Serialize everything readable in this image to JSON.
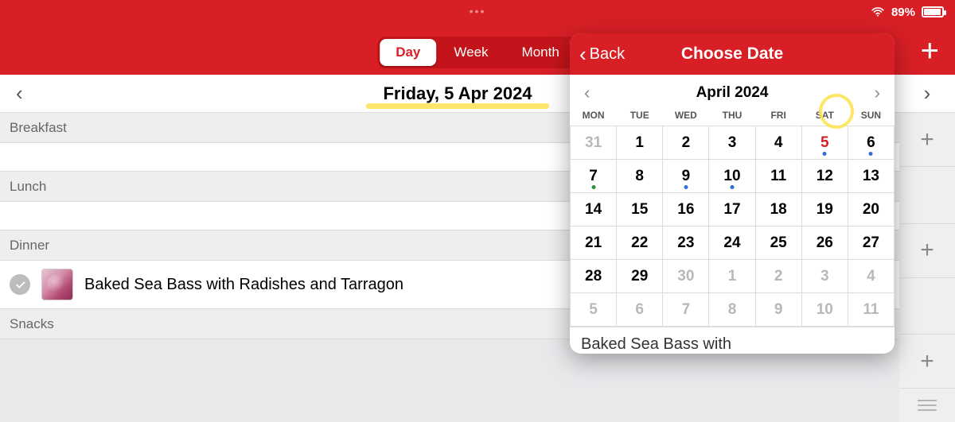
{
  "status": {
    "wifi": true,
    "battery_pct": "89%"
  },
  "segments": {
    "day": "Day",
    "week": "Week",
    "month": "Month",
    "active": "day"
  },
  "add_label": "+",
  "date_header": "Friday, 5 Apr 2024",
  "sections": {
    "breakfast": "Breakfast",
    "lunch": "Lunch",
    "dinner": "Dinner",
    "snacks": "Snacks"
  },
  "dinner_items": [
    {
      "name": "Baked Sea Bass with Radishes and Tarragon",
      "checked": true
    }
  ],
  "popover": {
    "back": "Back",
    "title": "Choose Date",
    "month_label": "April 2024",
    "dow": [
      "MON",
      "TUE",
      "WED",
      "THU",
      "FRI",
      "SAT",
      "SUN"
    ],
    "weeks": [
      [
        {
          "n": "31",
          "out": true
        },
        {
          "n": "1"
        },
        {
          "n": "2"
        },
        {
          "n": "3"
        },
        {
          "n": "4"
        },
        {
          "n": "5",
          "selected": true,
          "dot": "blue"
        },
        {
          "n": "6",
          "dot": "blue"
        }
      ],
      [
        {
          "n": "7",
          "dot": "green"
        },
        {
          "n": "8"
        },
        {
          "n": "9",
          "dot": "blue"
        },
        {
          "n": "10",
          "dot": "blue"
        },
        {
          "n": "11"
        },
        {
          "n": "12"
        },
        {
          "n": "13"
        }
      ],
      [
        {
          "n": "14"
        },
        {
          "n": "15"
        },
        {
          "n": "16"
        },
        {
          "n": "17"
        },
        {
          "n": "18"
        },
        {
          "n": "19"
        },
        {
          "n": "20"
        }
      ],
      [
        {
          "n": "21"
        },
        {
          "n": "22"
        },
        {
          "n": "23"
        },
        {
          "n": "24"
        },
        {
          "n": "25"
        },
        {
          "n": "26"
        },
        {
          "n": "27"
        }
      ],
      [
        {
          "n": "28"
        },
        {
          "n": "29"
        },
        {
          "n": "30",
          "out": true
        },
        {
          "n": "1",
          "out": true
        },
        {
          "n": "2",
          "out": true
        },
        {
          "n": "3",
          "out": true
        },
        {
          "n": "4",
          "out": true
        }
      ],
      [
        {
          "n": "5",
          "out": true
        },
        {
          "n": "6",
          "out": true
        },
        {
          "n": "7",
          "out": true
        },
        {
          "n": "8",
          "out": true
        },
        {
          "n": "9",
          "out": true
        },
        {
          "n": "10",
          "out": true
        },
        {
          "n": "11",
          "out": true
        }
      ]
    ],
    "footer_preview": "Baked Sea Bass with"
  }
}
